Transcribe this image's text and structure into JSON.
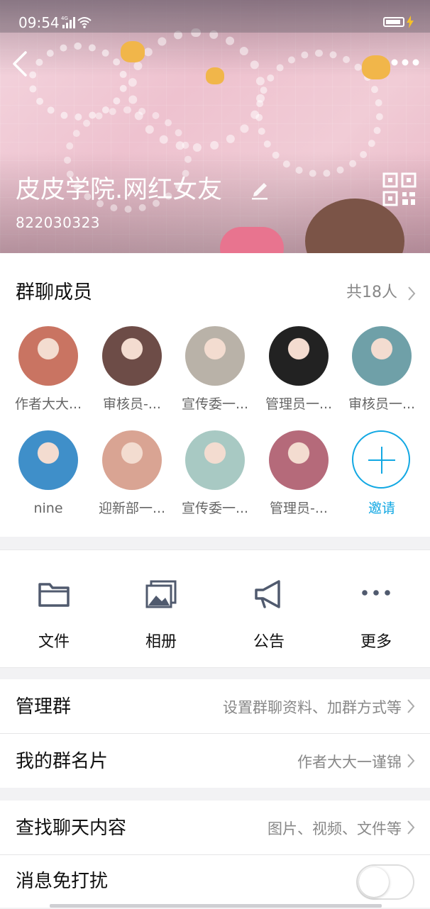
{
  "status_bar": {
    "time": "09:54",
    "network": "4G"
  },
  "header": {
    "group_name": "皮皮学院.网红女友",
    "group_id": "822030323"
  },
  "members": {
    "title": "群聊成员",
    "count": "共18人",
    "list": [
      {
        "name": "作者大大...",
        "color": "#c97462"
      },
      {
        "name": "审核员-...",
        "color": "#6d4c47"
      },
      {
        "name": "宣传委一...",
        "color": "#b9b2a8"
      },
      {
        "name": "管理员一...",
        "color": "#222222"
      },
      {
        "name": "审核员一...",
        "color": "#6fa0a8"
      },
      {
        "name": "nine",
        "color": "#3f8fc9"
      },
      {
        "name": "迎新部一...",
        "color": "#d9a493"
      },
      {
        "name": "宣传委一...",
        "color": "#a8c9c3"
      },
      {
        "name": "管理员-...",
        "color": "#b56a7a"
      }
    ],
    "invite_label": "邀请",
    "invite_color": "#12a8e3"
  },
  "actions": [
    {
      "label": "文件",
      "icon": "folder-icon"
    },
    {
      "label": "相册",
      "icon": "album-icon"
    },
    {
      "label": "公告",
      "icon": "megaphone-icon"
    },
    {
      "label": "更多",
      "icon": "more-dots-icon"
    }
  ],
  "rows": {
    "manage": {
      "label": "管理群",
      "value": "设置群聊资料、加群方式等"
    },
    "card": {
      "label": "我的群名片",
      "value": "作者大大一谨锦"
    },
    "search": {
      "label": "查找聊天内容",
      "value": "图片、视频、文件等"
    },
    "mute": {
      "label": "消息免打扰",
      "enabled": false
    }
  }
}
